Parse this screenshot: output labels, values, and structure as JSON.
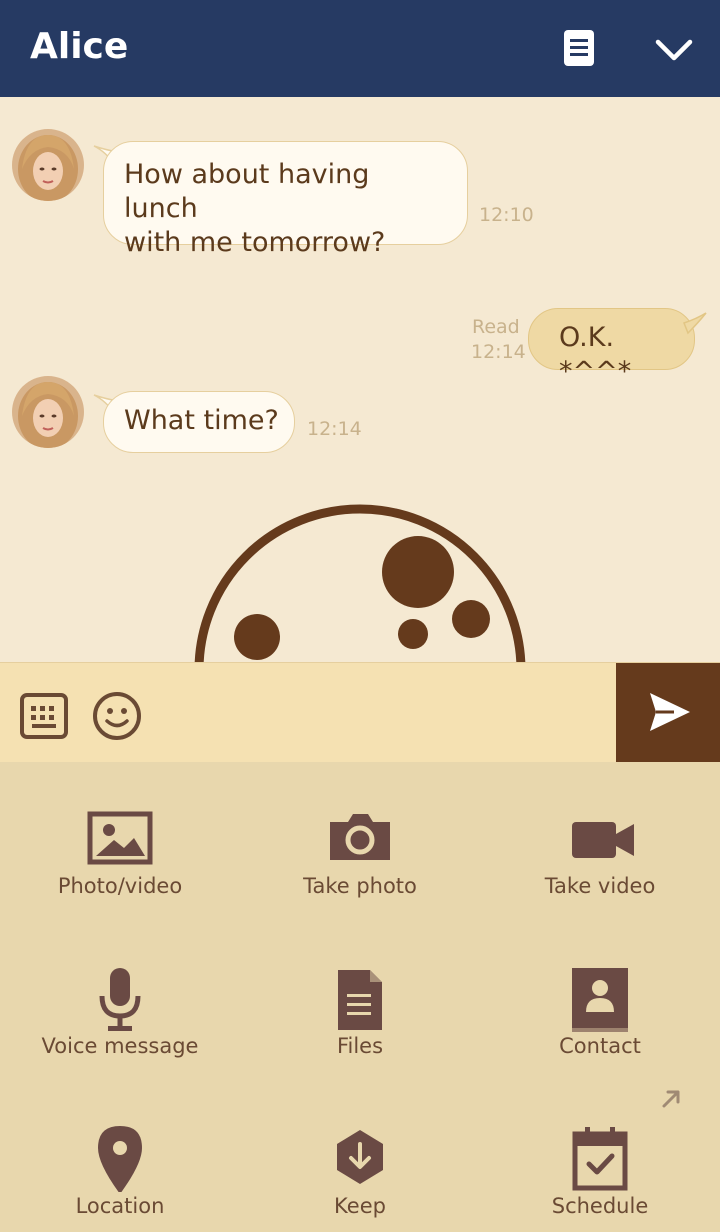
{
  "header": {
    "title": "Alice",
    "notes_icon": "notes-icon",
    "collapse_icon": "chevron-down-icon"
  },
  "messages": [
    {
      "from": "Alice",
      "direction": "in",
      "lines": [
        "How about having lunch",
        "with me tomorrow?"
      ],
      "time": "12:10"
    },
    {
      "from": "me",
      "direction": "out",
      "text": "O.K. *^^*",
      "status": "Read",
      "time": "12:14"
    },
    {
      "from": "Alice",
      "direction": "in",
      "text": "What time?",
      "time": "12:14"
    }
  ],
  "input": {
    "keyboard_icon": "keyboard-icon",
    "emoji_icon": "emoji-icon",
    "send_icon": "send-icon"
  },
  "menu": {
    "items": [
      {
        "label": "Photo/video",
        "icon": "image-icon"
      },
      {
        "label": "Take photo",
        "icon": "camera-icon"
      },
      {
        "label": "Take video",
        "icon": "video-camera-icon"
      },
      {
        "label": "Voice message",
        "icon": "microphone-icon"
      },
      {
        "label": "Files",
        "icon": "file-icon"
      },
      {
        "label": "Contact",
        "icon": "contact-icon"
      },
      {
        "label": "Location",
        "icon": "location-pin-icon"
      },
      {
        "label": "Keep",
        "icon": "keep-icon"
      },
      {
        "label": "Schedule",
        "icon": "calendar-icon"
      }
    ],
    "expand_icon": "expand-arrow-icon"
  },
  "colors": {
    "header_bg": "#263a63",
    "chat_bg": "#f5e9d2",
    "accent_brown": "#653a1c",
    "menu_bg": "#e8d7ad",
    "input_bg": "#f5e1b2",
    "out_bubble": "#efd9a4"
  }
}
